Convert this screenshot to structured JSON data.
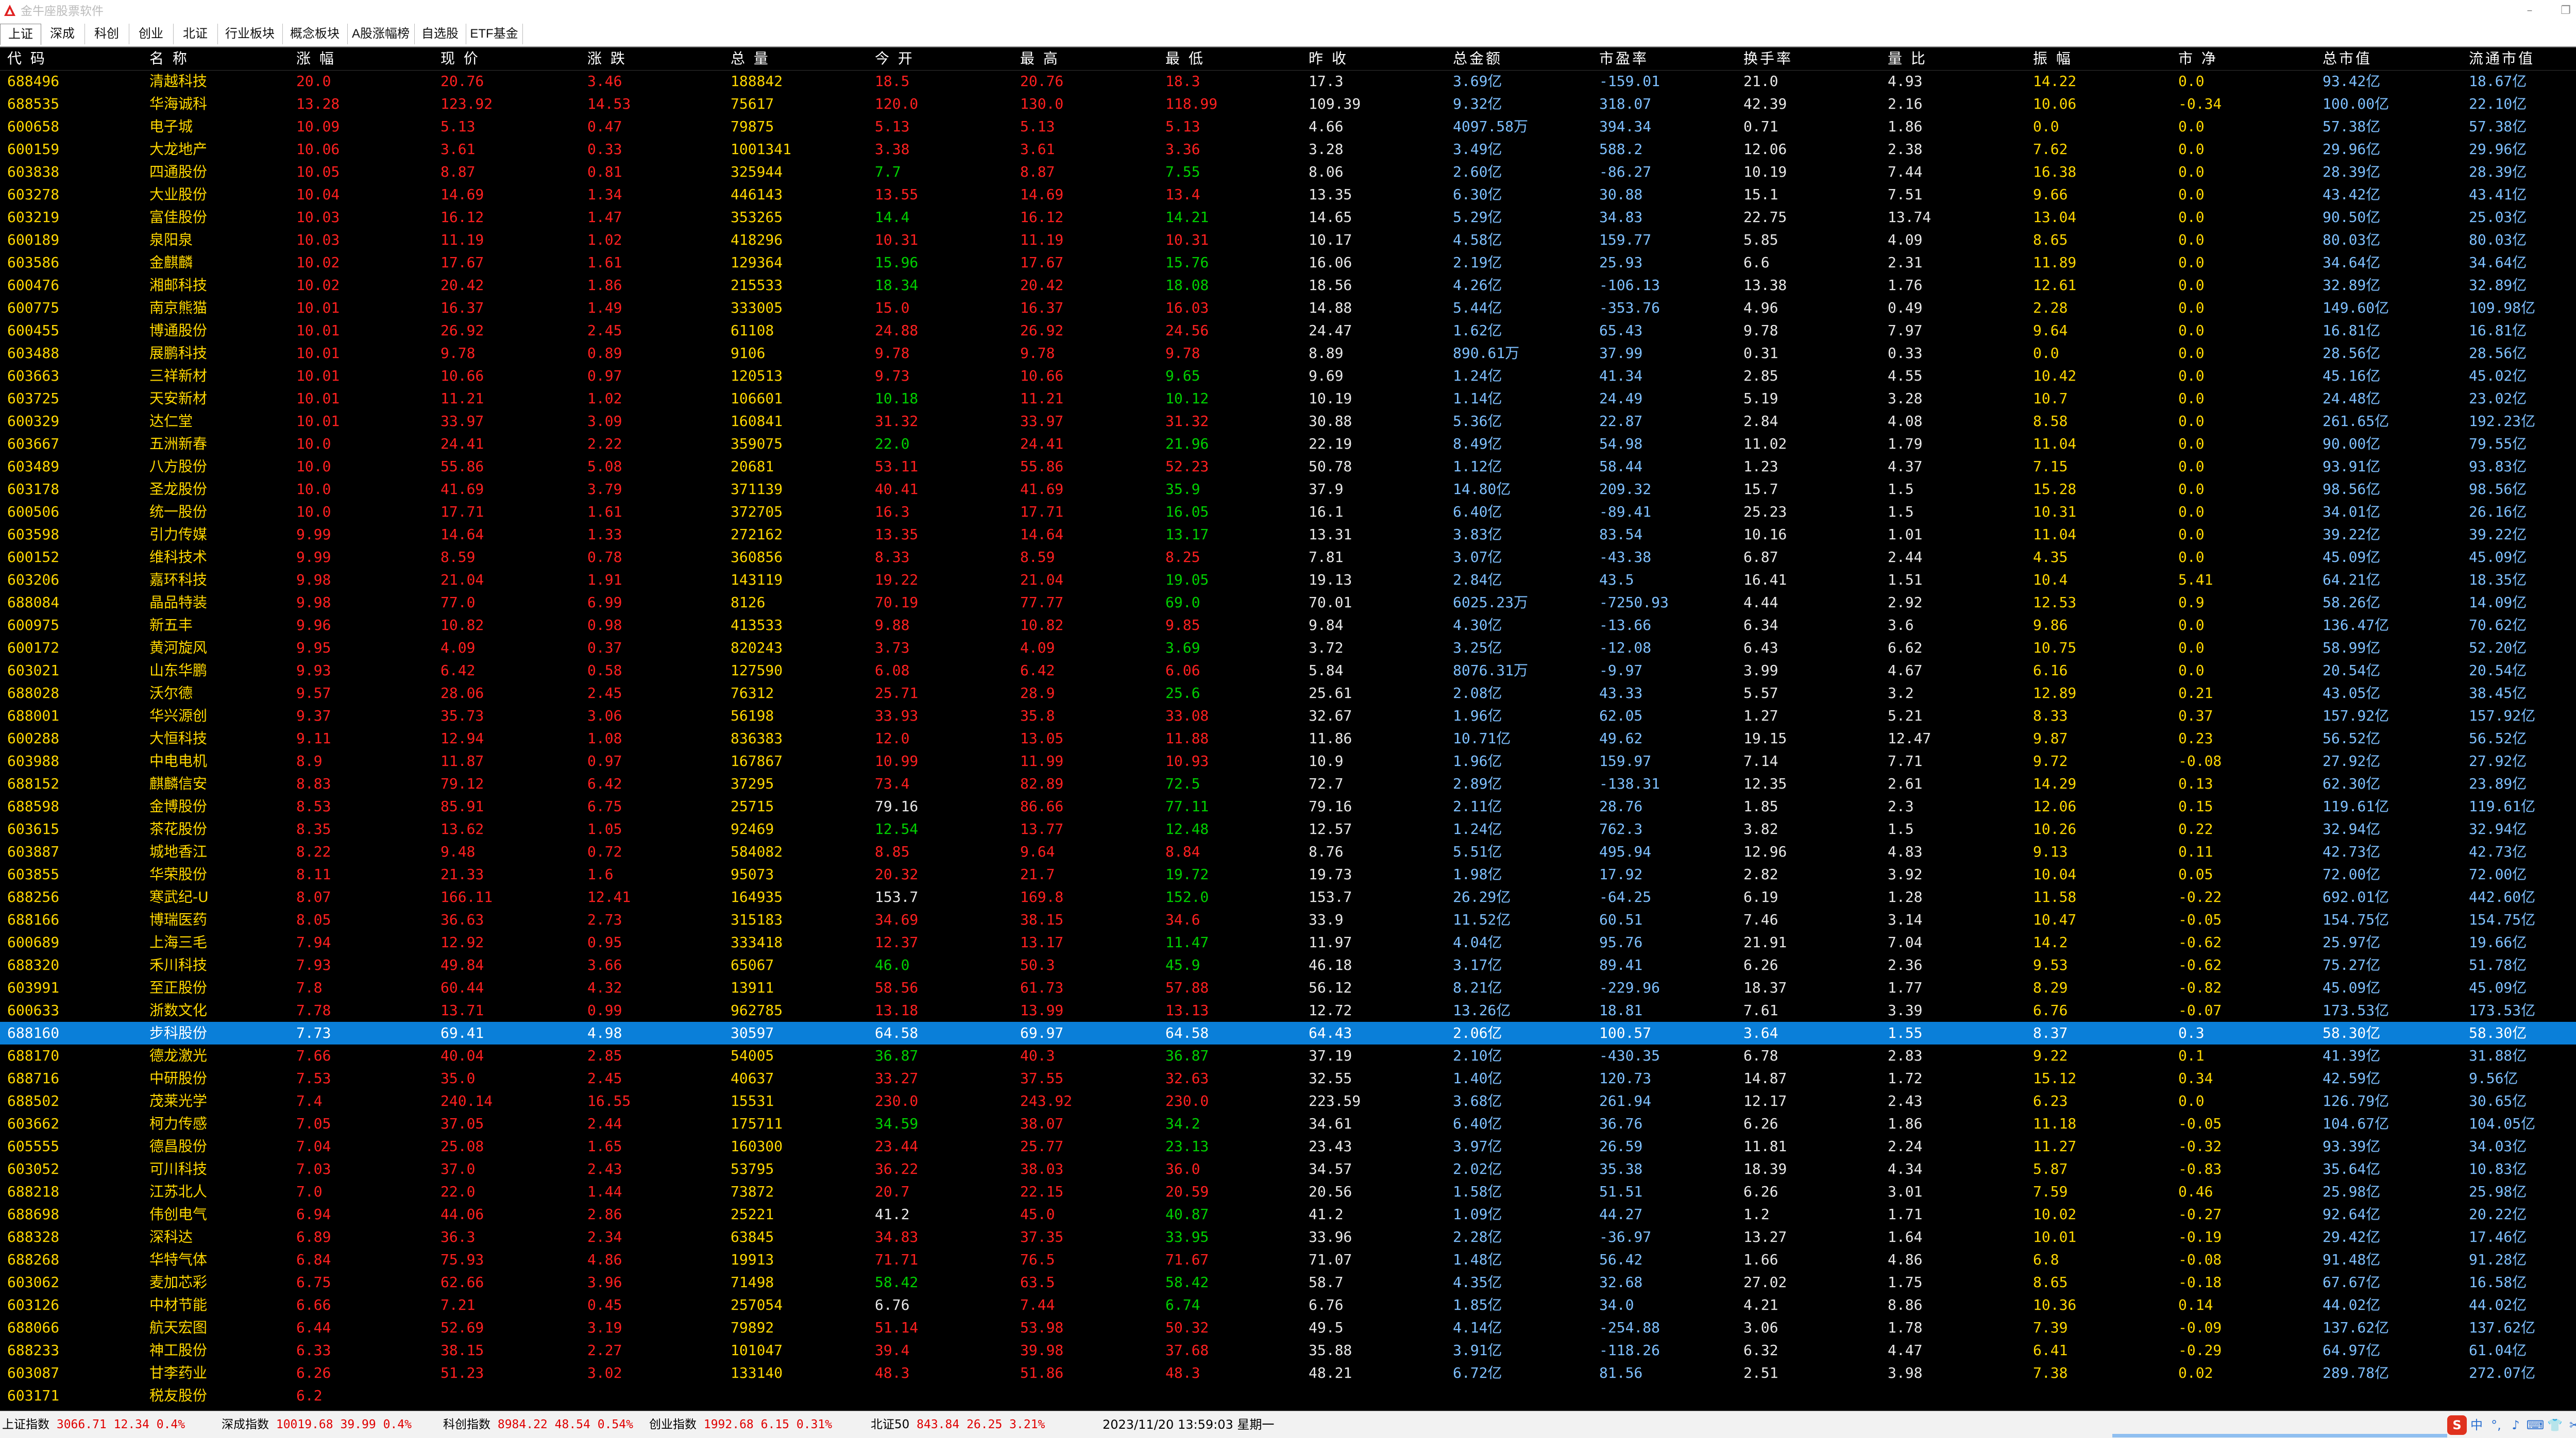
{
  "window": {
    "title": "金牛座股票软件",
    "logo_icon": "app-logo-icon",
    "controls": [
      "minimize-icon",
      "restore-icon",
      "close-icon"
    ]
  },
  "tabs": [
    "上证",
    "深成",
    "科创",
    "创业",
    "北证",
    "行业板块",
    "概念板块",
    "A股涨幅榜",
    "自选股",
    "ETF基金"
  ],
  "active_tab": 0,
  "columns": [
    "代 码",
    "名 称",
    "涨 幅",
    "现 价",
    "涨 跌",
    "总 量",
    "今 开",
    "最 高",
    "最 低",
    "昨 收",
    "总金额",
    "市盈率",
    "换手率",
    "量 比",
    "振 幅",
    "市 净",
    "总市值",
    "流通市值"
  ],
  "selected_row": 42,
  "colors": {
    "up": "#ff2020",
    "down": "#00d000",
    "neutral": "#e8e8e8",
    "code": "#ffd700",
    "amount": "#7ec0ff",
    "selection": "#0a7fd9"
  },
  "rows": [
    [
      "688496",
      "清越科技",
      "20.0",
      "20.76",
      "3.46",
      "188842",
      "18.5",
      "20.76",
      "18.3",
      "17.3",
      "3.69亿",
      "-159.01",
      "21.0",
      "4.93",
      "14.22",
      "0.0",
      "93.42亿",
      "18.67亿"
    ],
    [
      "688535",
      "华海诚科",
      "13.28",
      "123.92",
      "14.53",
      "75617",
      "120.0",
      "130.0",
      "118.99",
      "109.39",
      "9.32亿",
      "318.07",
      "42.39",
      "2.16",
      "10.06",
      "-0.34",
      "100.00亿",
      "22.10亿"
    ],
    [
      "600658",
      "电子城",
      "10.09",
      "5.13",
      "0.47",
      "79875",
      "5.13",
      "5.13",
      "5.13",
      "4.66",
      "4097.58万",
      "394.34",
      "0.71",
      "1.86",
      "0.0",
      "0.0",
      "57.38亿",
      "57.38亿"
    ],
    [
      "600159",
      "大龙地产",
      "10.06",
      "3.61",
      "0.33",
      "1001341",
      "3.38",
      "3.61",
      "3.36",
      "3.28",
      "3.49亿",
      "588.2",
      "12.06",
      "2.38",
      "7.62",
      "0.0",
      "29.96亿",
      "29.96亿"
    ],
    [
      "603838",
      "四通股份",
      "10.05",
      "8.87",
      "0.81",
      "325944",
      "7.7",
      "8.87",
      "7.55",
      "8.06",
      "2.60亿",
      "-86.27",
      "10.19",
      "7.44",
      "16.38",
      "0.0",
      "28.39亿",
      "28.39亿"
    ],
    [
      "603278",
      "大业股份",
      "10.04",
      "14.69",
      "1.34",
      "446143",
      "13.55",
      "14.69",
      "13.4",
      "13.35",
      "6.30亿",
      "30.88",
      "15.1",
      "7.51",
      "9.66",
      "0.0",
      "43.42亿",
      "43.41亿"
    ],
    [
      "603219",
      "富佳股份",
      "10.03",
      "16.12",
      "1.47",
      "353265",
      "14.4",
      "16.12",
      "14.21",
      "14.65",
      "5.29亿",
      "34.83",
      "22.75",
      "13.74",
      "13.04",
      "0.0",
      "90.50亿",
      "25.03亿"
    ],
    [
      "600189",
      "泉阳泉",
      "10.03",
      "11.19",
      "1.02",
      "418296",
      "10.31",
      "11.19",
      "10.31",
      "10.17",
      "4.58亿",
      "159.77",
      "5.85",
      "4.09",
      "8.65",
      "0.0",
      "80.03亿",
      "80.03亿"
    ],
    [
      "603586",
      "金麒麟",
      "10.02",
      "17.67",
      "1.61",
      "129364",
      "15.96",
      "17.67",
      "15.76",
      "16.06",
      "2.19亿",
      "25.93",
      "6.6",
      "2.31",
      "11.89",
      "0.0",
      "34.64亿",
      "34.64亿"
    ],
    [
      "600476",
      "湘邮科技",
      "10.02",
      "20.42",
      "1.86",
      "215533",
      "18.34",
      "20.42",
      "18.08",
      "18.56",
      "4.26亿",
      "-106.13",
      "13.38",
      "1.76",
      "12.61",
      "0.0",
      "32.89亿",
      "32.89亿"
    ],
    [
      "600775",
      "南京熊猫",
      "10.01",
      "16.37",
      "1.49",
      "333005",
      "15.0",
      "16.37",
      "16.03",
      "14.88",
      "5.44亿",
      "-353.76",
      "4.96",
      "0.49",
      "2.28",
      "0.0",
      "149.60亿",
      "109.98亿"
    ],
    [
      "600455",
      "博通股份",
      "10.01",
      "26.92",
      "2.45",
      "61108",
      "24.88",
      "26.92",
      "24.56",
      "24.47",
      "1.62亿",
      "65.43",
      "9.78",
      "7.97",
      "9.64",
      "0.0",
      "16.81亿",
      "16.81亿"
    ],
    [
      "603488",
      "展鹏科技",
      "10.01",
      "9.78",
      "0.89",
      "9106",
      "9.78",
      "9.78",
      "9.78",
      "8.89",
      "890.61万",
      "37.99",
      "0.31",
      "0.33",
      "0.0",
      "0.0",
      "28.56亿",
      "28.56亿"
    ],
    [
      "603663",
      "三祥新材",
      "10.01",
      "10.66",
      "0.97",
      "120513",
      "9.73",
      "10.66",
      "9.65",
      "9.69",
      "1.24亿",
      "41.34",
      "2.85",
      "4.55",
      "10.42",
      "0.0",
      "45.16亿",
      "45.02亿"
    ],
    [
      "603725",
      "天安新材",
      "10.01",
      "11.21",
      "1.02",
      "106601",
      "10.18",
      "11.21",
      "10.12",
      "10.19",
      "1.14亿",
      "24.49",
      "5.19",
      "3.28",
      "10.7",
      "0.0",
      "24.48亿",
      "23.02亿"
    ],
    [
      "600329",
      "达仁堂",
      "10.01",
      "33.97",
      "3.09",
      "160841",
      "31.32",
      "33.97",
      "31.32",
      "30.88",
      "5.36亿",
      "22.87",
      "2.84",
      "4.08",
      "8.58",
      "0.0",
      "261.65亿",
      "192.23亿"
    ],
    [
      "603667",
      "五洲新春",
      "10.0",
      "24.41",
      "2.22",
      "359075",
      "22.0",
      "24.41",
      "21.96",
      "22.19",
      "8.49亿",
      "54.98",
      "11.02",
      "1.79",
      "11.04",
      "0.0",
      "90.00亿",
      "79.55亿"
    ],
    [
      "603489",
      "八方股份",
      "10.0",
      "55.86",
      "5.08",
      "20681",
      "53.11",
      "55.86",
      "52.23",
      "50.78",
      "1.12亿",
      "58.44",
      "1.23",
      "4.37",
      "7.15",
      "0.0",
      "93.91亿",
      "93.83亿"
    ],
    [
      "603178",
      "圣龙股份",
      "10.0",
      "41.69",
      "3.79",
      "371139",
      "40.41",
      "41.69",
      "35.9",
      "37.9",
      "14.80亿",
      "209.32",
      "15.7",
      "1.5",
      "15.28",
      "0.0",
      "98.56亿",
      "98.56亿"
    ],
    [
      "600506",
      "统一股份",
      "10.0",
      "17.71",
      "1.61",
      "372705",
      "16.3",
      "17.71",
      "16.05",
      "16.1",
      "6.40亿",
      "-89.41",
      "25.23",
      "1.5",
      "10.31",
      "0.0",
      "34.01亿",
      "26.16亿"
    ],
    [
      "603598",
      "引力传媒",
      "9.99",
      "14.64",
      "1.33",
      "272162",
      "13.35",
      "14.64",
      "13.17",
      "13.31",
      "3.83亿",
      "83.54",
      "10.16",
      "1.01",
      "11.04",
      "0.0",
      "39.22亿",
      "39.22亿"
    ],
    [
      "600152",
      "维科技术",
      "9.99",
      "8.59",
      "0.78",
      "360856",
      "8.33",
      "8.59",
      "8.25",
      "7.81",
      "3.07亿",
      "-43.38",
      "6.87",
      "2.44",
      "4.35",
      "0.0",
      "45.09亿",
      "45.09亿"
    ],
    [
      "603206",
      "嘉环科技",
      "9.98",
      "21.04",
      "1.91",
      "143119",
      "19.22",
      "21.04",
      "19.05",
      "19.13",
      "2.84亿",
      "43.5",
      "16.41",
      "1.51",
      "10.4",
      "5.41",
      "64.21亿",
      "18.35亿"
    ],
    [
      "688084",
      "晶品特装",
      "9.98",
      "77.0",
      "6.99",
      "8126",
      "70.19",
      "77.77",
      "69.0",
      "70.01",
      "6025.23万",
      "-7250.93",
      "4.44",
      "2.92",
      "12.53",
      "0.9",
      "58.26亿",
      "14.09亿"
    ],
    [
      "600975",
      "新五丰",
      "9.96",
      "10.82",
      "0.98",
      "413533",
      "9.88",
      "10.82",
      "9.85",
      "9.84",
      "4.30亿",
      "-13.66",
      "6.34",
      "3.6",
      "9.86",
      "0.0",
      "136.47亿",
      "70.62亿"
    ],
    [
      "600172",
      "黄河旋风",
      "9.95",
      "4.09",
      "0.37",
      "820243",
      "3.73",
      "4.09",
      "3.69",
      "3.72",
      "3.25亿",
      "-12.08",
      "6.43",
      "6.62",
      "10.75",
      "0.0",
      "58.99亿",
      "52.20亿"
    ],
    [
      "603021",
      "山东华鹏",
      "9.93",
      "6.42",
      "0.58",
      "127590",
      "6.08",
      "6.42",
      "6.06",
      "5.84",
      "8076.31万",
      "-9.97",
      "3.99",
      "4.67",
      "6.16",
      "0.0",
      "20.54亿",
      "20.54亿"
    ],
    [
      "688028",
      "沃尔德",
      "9.57",
      "28.06",
      "2.45",
      "76312",
      "25.71",
      "28.9",
      "25.6",
      "25.61",
      "2.08亿",
      "43.33",
      "5.57",
      "3.2",
      "12.89",
      "0.21",
      "43.05亿",
      "38.45亿"
    ],
    [
      "688001",
      "华兴源创",
      "9.37",
      "35.73",
      "3.06",
      "56198",
      "33.93",
      "35.8",
      "33.08",
      "32.67",
      "1.96亿",
      "62.05",
      "1.27",
      "5.21",
      "8.33",
      "0.37",
      "157.92亿",
      "157.92亿"
    ],
    [
      "600288",
      "大恒科技",
      "9.11",
      "12.94",
      "1.08",
      "836383",
      "12.0",
      "13.05",
      "11.88",
      "11.86",
      "10.71亿",
      "49.62",
      "19.15",
      "12.47",
      "9.87",
      "0.23",
      "56.52亿",
      "56.52亿"
    ],
    [
      "603988",
      "中电电机",
      "8.9",
      "11.87",
      "0.97",
      "167867",
      "10.99",
      "11.99",
      "10.93",
      "10.9",
      "1.96亿",
      "159.97",
      "7.14",
      "7.71",
      "9.72",
      "-0.08",
      "27.92亿",
      "27.92亿"
    ],
    [
      "688152",
      "麒麟信安",
      "8.83",
      "79.12",
      "6.42",
      "37295",
      "73.4",
      "82.89",
      "72.5",
      "72.7",
      "2.89亿",
      "-138.31",
      "12.35",
      "2.61",
      "14.29",
      "0.13",
      "62.30亿",
      "23.89亿"
    ],
    [
      "688598",
      "金博股份",
      "8.53",
      "85.91",
      "6.75",
      "25715",
      "79.16",
      "86.66",
      "77.11",
      "79.16",
      "2.11亿",
      "28.76",
      "1.85",
      "2.3",
      "12.06",
      "0.15",
      "119.61亿",
      "119.61亿"
    ],
    [
      "603615",
      "茶花股份",
      "8.35",
      "13.62",
      "1.05",
      "92469",
      "12.54",
      "13.77",
      "12.48",
      "12.57",
      "1.24亿",
      "762.3",
      "3.82",
      "1.5",
      "10.26",
      "0.22",
      "32.94亿",
      "32.94亿"
    ],
    [
      "603887",
      "城地香江",
      "8.22",
      "9.48",
      "0.72",
      "584082",
      "8.85",
      "9.64",
      "8.84",
      "8.76",
      "5.51亿",
      "495.94",
      "12.96",
      "4.83",
      "9.13",
      "0.11",
      "42.73亿",
      "42.73亿"
    ],
    [
      "603855",
      "华荣股份",
      "8.11",
      "21.33",
      "1.6",
      "95073",
      "20.32",
      "21.7",
      "19.72",
      "19.73",
      "1.98亿",
      "17.92",
      "2.82",
      "3.92",
      "10.04",
      "0.05",
      "72.00亿",
      "72.00亿"
    ],
    [
      "688256",
      "寒武纪-U",
      "8.07",
      "166.11",
      "12.41",
      "164935",
      "153.7",
      "169.8",
      "152.0",
      "153.7",
      "26.29亿",
      "-64.25",
      "6.19",
      "1.28",
      "11.58",
      "-0.22",
      "692.01亿",
      "442.60亿"
    ],
    [
      "688166",
      "博瑞医药",
      "8.05",
      "36.63",
      "2.73",
      "315183",
      "34.69",
      "38.15",
      "34.6",
      "33.9",
      "11.52亿",
      "60.51",
      "7.46",
      "3.14",
      "10.47",
      "-0.05",
      "154.75亿",
      "154.75亿"
    ],
    [
      "600689",
      "上海三毛",
      "7.94",
      "12.92",
      "0.95",
      "333418",
      "12.37",
      "13.17",
      "11.47",
      "11.97",
      "4.04亿",
      "95.76",
      "21.91",
      "7.04",
      "14.2",
      "-0.62",
      "25.97亿",
      "19.66亿"
    ],
    [
      "688320",
      "禾川科技",
      "7.93",
      "49.84",
      "3.66",
      "65067",
      "46.0",
      "50.3",
      "45.9",
      "46.18",
      "3.17亿",
      "89.41",
      "6.26",
      "2.36",
      "9.53",
      "-0.62",
      "75.27亿",
      "51.78亿"
    ],
    [
      "603991",
      "至正股份",
      "7.8",
      "60.44",
      "4.32",
      "13911",
      "58.56",
      "61.73",
      "57.88",
      "56.12",
      "8.21亿",
      "-229.96",
      "18.37",
      "1.77",
      "8.29",
      "-0.82",
      "45.09亿",
      "45.09亿"
    ],
    [
      "600633",
      "浙数文化",
      "7.78",
      "13.71",
      "0.99",
      "962785",
      "13.18",
      "13.99",
      "13.13",
      "12.72",
      "13.26亿",
      "18.81",
      "7.61",
      "3.39",
      "6.76",
      "-0.07",
      "173.53亿",
      "173.53亿"
    ],
    [
      "688160",
      "步科股份",
      "7.73",
      "69.41",
      "4.98",
      "30597",
      "64.58",
      "69.97",
      "64.58",
      "64.43",
      "2.06亿",
      "100.57",
      "3.64",
      "1.55",
      "8.37",
      "0.3",
      "58.30亿",
      "58.30亿"
    ],
    [
      "688170",
      "德龙激光",
      "7.66",
      "40.04",
      "2.85",
      "54005",
      "36.87",
      "40.3",
      "36.87",
      "37.19",
      "2.10亿",
      "-430.35",
      "6.78",
      "2.83",
      "9.22",
      "0.1",
      "41.39亿",
      "31.88亿"
    ],
    [
      "688716",
      "中研股份",
      "7.53",
      "35.0",
      "2.45",
      "40637",
      "33.27",
      "37.55",
      "32.63",
      "32.55",
      "1.40亿",
      "120.73",
      "14.87",
      "1.72",
      "15.12",
      "0.34",
      "42.59亿",
      "9.56亿"
    ],
    [
      "688502",
      "茂莱光学",
      "7.4",
      "240.14",
      "16.55",
      "15531",
      "230.0",
      "243.92",
      "230.0",
      "223.59",
      "3.68亿",
      "261.94",
      "12.17",
      "2.43",
      "6.23",
      "0.0",
      "126.79亿",
      "30.65亿"
    ],
    [
      "603662",
      "柯力传感",
      "7.05",
      "37.05",
      "2.44",
      "175711",
      "34.59",
      "38.07",
      "34.2",
      "34.61",
      "6.40亿",
      "36.76",
      "6.26",
      "1.86",
      "11.18",
      "-0.05",
      "104.67亿",
      "104.05亿"
    ],
    [
      "605555",
      "德昌股份",
      "7.04",
      "25.08",
      "1.65",
      "160300",
      "23.44",
      "25.77",
      "23.13",
      "23.43",
      "3.97亿",
      "26.59",
      "11.81",
      "2.24",
      "11.27",
      "-0.32",
      "93.39亿",
      "34.03亿"
    ],
    [
      "603052",
      "可川科技",
      "7.03",
      "37.0",
      "2.43",
      "53795",
      "36.22",
      "38.03",
      "36.0",
      "34.57",
      "2.02亿",
      "35.38",
      "18.39",
      "4.34",
      "5.87",
      "-0.83",
      "35.64亿",
      "10.83亿"
    ],
    [
      "688218",
      "江苏北人",
      "7.0",
      "22.0",
      "1.44",
      "73872",
      "20.7",
      "22.15",
      "20.59",
      "20.56",
      "1.58亿",
      "51.51",
      "6.26",
      "3.01",
      "7.59",
      "0.46",
      "25.98亿",
      "25.98亿"
    ],
    [
      "688698",
      "伟创电气",
      "6.94",
      "44.06",
      "2.86",
      "25221",
      "41.2",
      "45.0",
      "40.87",
      "41.2",
      "1.09亿",
      "44.27",
      "1.2",
      "1.71",
      "10.02",
      "-0.27",
      "92.64亿",
      "20.22亿"
    ],
    [
      "688328",
      "深科达",
      "6.89",
      "36.3",
      "2.34",
      "63845",
      "34.83",
      "37.35",
      "33.95",
      "33.96",
      "2.28亿",
      "-36.97",
      "13.27",
      "1.64",
      "10.01",
      "-0.19",
      "29.42亿",
      "17.46亿"
    ],
    [
      "688268",
      "华特气体",
      "6.84",
      "75.93",
      "4.86",
      "19913",
      "71.71",
      "76.5",
      "71.67",
      "71.07",
      "1.48亿",
      "56.42",
      "1.66",
      "4.86",
      "6.8",
      "-0.08",
      "91.48亿",
      "91.28亿"
    ],
    [
      "603062",
      "麦加芯彩",
      "6.75",
      "62.66",
      "3.96",
      "71498",
      "58.42",
      "63.5",
      "58.42",
      "58.7",
      "4.35亿",
      "32.68",
      "27.02",
      "1.75",
      "8.65",
      "-0.18",
      "67.67亿",
      "16.58亿"
    ],
    [
      "603126",
      "中材节能",
      "6.66",
      "7.21",
      "0.45",
      "257054",
      "6.76",
      "7.44",
      "6.74",
      "6.76",
      "1.85亿",
      "34.0",
      "4.21",
      "8.86",
      "10.36",
      "0.14",
      "44.02亿",
      "44.02亿"
    ],
    [
      "688066",
      "航天宏图",
      "6.44",
      "52.69",
      "3.19",
      "79892",
      "51.14",
      "53.98",
      "50.32",
      "49.5",
      "4.14亿",
      "-254.88",
      "3.06",
      "1.78",
      "7.39",
      "-0.09",
      "137.62亿",
      "137.62亿"
    ],
    [
      "688233",
      "神工股份",
      "6.33",
      "38.15",
      "2.27",
      "101047",
      "39.4",
      "39.98",
      "37.68",
      "35.88",
      "3.91亿",
      "-118.26",
      "6.32",
      "4.47",
      "6.41",
      "-0.29",
      "64.97亿",
      "61.04亿"
    ],
    [
      "603087",
      "甘李药业",
      "6.26",
      "51.23",
      "3.02",
      "133140",
      "48.3",
      "51.86",
      "48.3",
      "48.21",
      "6.72亿",
      "81.56",
      "2.51",
      "3.98",
      "7.38",
      "0.02",
      "289.78亿",
      "272.07亿"
    ],
    [
      "603171",
      "税友股份",
      "6.2",
      "",
      "",
      "",
      "",
      "",
      "",
      "",
      "",
      "",
      "",
      "",
      "",
      "",
      "",
      ""
    ]
  ],
  "status": {
    "indices": [
      {
        "label": "上证指数",
        "value": "3066.71",
        "change": "12.34",
        "pct": "0.4%"
      },
      {
        "label": "深成指数",
        "value": "10019.68",
        "change": "39.99",
        "pct": "0.4%"
      },
      {
        "label": "科创指数",
        "value": "8984.22",
        "change": "48.54",
        "pct": "0.54%"
      },
      {
        "label": "创业指数",
        "value": "1992.68",
        "change": "6.15",
        "pct": "0.31%"
      },
      {
        "label": "北证50",
        "value": "843.84",
        "change": "26.25",
        "pct": "3.21%"
      }
    ],
    "datetime": "2023/11/20 13:59:03 星期一"
  },
  "tray": {
    "ime_label": "中",
    "icons": [
      "sogou-ime-icon",
      "punctuation-icon",
      "microphone-icon",
      "keyboard-icon",
      "skin-icon",
      "toolbox-icon",
      "menu-grid-icon"
    ]
  }
}
